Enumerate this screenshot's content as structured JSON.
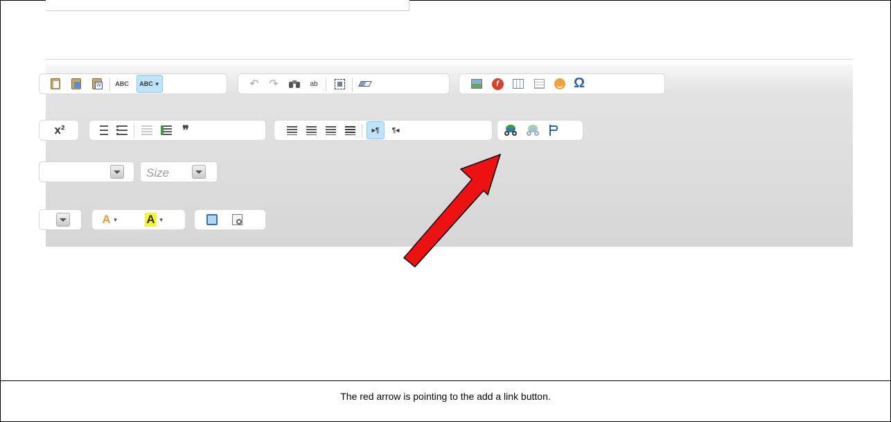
{
  "editor": {
    "size_combo_label": "Size",
    "superscript_label": "x²",
    "spellcheck_label": "ABC",
    "special_char_label": "Ω",
    "blockquote_label": "❞",
    "ltr_label": "▸¶",
    "rtl_label": "¶◂",
    "text_color_label": "A",
    "bg_color_label": "A"
  },
  "annotation": {
    "arrow_color": "#ee1111",
    "caption": "The red arrow is pointing to the add a link button."
  },
  "colors": {
    "active_button_bg": "#bfe3f8",
    "toolbar_bg": "#d6d6d6",
    "link_icon_green": "#3a9a47",
    "link_icon_blue": "#2f73b8",
    "flash_red": "#d9412b",
    "smiley": "#f3a13a"
  },
  "icons": {
    "paste": "clipboard-icon",
    "paste_text": "clipboard-text-icon",
    "paste_word": "clipboard-word-icon",
    "spellcheck": "spellcheck-icon",
    "spellcheck_ayt": "spellcheck-as-you-type-icon",
    "undo": "undo-icon",
    "redo": "redo-icon",
    "find": "binoculars-icon",
    "replace": "find-replace-icon",
    "select_all": "select-all-icon",
    "remove_format": "eraser-icon",
    "image": "image-icon",
    "flash": "flash-icon",
    "table": "table-icon",
    "horizontal_rule": "horizontal-rule-icon",
    "smiley": "smiley-icon",
    "special_char": "omega-icon",
    "link": "link-icon",
    "unlink": "unlink-icon",
    "anchor": "anchor-flag-icon",
    "maximize": "maximize-icon",
    "show_blocks": "show-blocks-icon"
  }
}
